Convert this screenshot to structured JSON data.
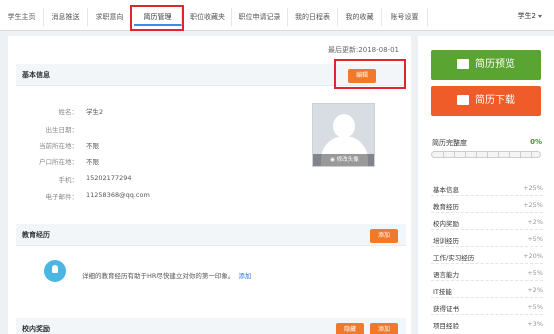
{
  "nav": {
    "tabs": [
      "学生主页",
      "消息推送",
      "求职意向",
      "简历管理",
      "职位收藏夹",
      "职位申请记录",
      "我的日程表",
      "我的收藏",
      "账号设置"
    ],
    "active_tab": "简历管理",
    "user": "学生2"
  },
  "main": {
    "updated": "最后更新:2018-08-01",
    "basic": {
      "title": "基本信息",
      "edit": "编辑",
      "fields": [
        {
          "label": "姓名：",
          "value": "学生2"
        },
        {
          "label": "出生日期：",
          "value": ""
        },
        {
          "label": "当前所在地：",
          "value": "不限"
        },
        {
          "label": "户口所在地：",
          "value": "不限"
        },
        {
          "label": "手机：",
          "value": "15202177294"
        },
        {
          "label": "电子邮件：",
          "value": "11258368@qq.com"
        }
      ],
      "avatar_caption": "修改头像"
    },
    "education": {
      "title": "教育经历",
      "add": "添加",
      "tip": "详细的教育经历有助于HR尽快建立对你的第一印象。",
      "tip_link": "添加"
    },
    "awards": {
      "title": "校内奖励",
      "hide": "隐藏",
      "add": "添加"
    }
  },
  "sidebar": {
    "preview": "简历预览",
    "download": "简历下载",
    "progress_label": "简历完整度",
    "progress_pct": "0%",
    "progress_value": 0,
    "sections": [
      {
        "name": "基本信息",
        "pct": "+25%"
      },
      {
        "name": "教育经历",
        "pct": "+25%"
      },
      {
        "name": "校内奖励",
        "pct": "+2%"
      },
      {
        "name": "培训经历",
        "pct": "+5%"
      },
      {
        "name": "工作/实习经历",
        "pct": "+20%"
      },
      {
        "name": "语言能力",
        "pct": "+5%"
      },
      {
        "name": "IT技能",
        "pct": "+2%"
      },
      {
        "name": "获得证书",
        "pct": "+5%"
      },
      {
        "name": "项目经验",
        "pct": "+3%"
      }
    ]
  },
  "colors": {
    "accent_orange": "#f07a2a",
    "preview_green": "#5aa431",
    "download_orange": "#f05b2a",
    "highlight_red": "#e0262a"
  }
}
